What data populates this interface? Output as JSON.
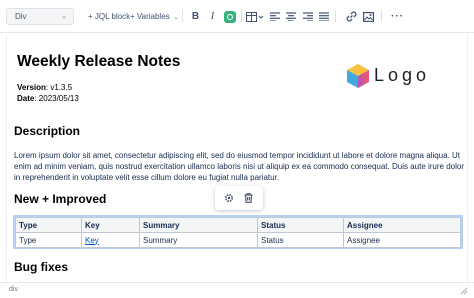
{
  "toolbar": {
    "block_type": "Div",
    "jql_block": "+ JQL block",
    "variables": "+ Variables",
    "accent_color": "#36b37e",
    "icons": [
      "bold-icon",
      "italic-icon",
      "text-color-icon",
      "table-icon",
      "align-left-icon",
      "align-center-icon",
      "align-right-icon",
      "align-justify-icon",
      "link-icon",
      "image-icon",
      "more-icon"
    ]
  },
  "document": {
    "title": "Weekly Release Notes",
    "version_label": "Version",
    "version_value": ": v1.3.5",
    "date_label": "Date",
    "date_value": ": 2023/05/13",
    "logo_text": "Logo",
    "description_heading": "Description",
    "description_text": "Lorem ipsum dolor sit amet, consectetur adipiscing elit, sed do eiusmod tempor incididunt ut labore et dolore magna aliqua. Ut enim ad minim veniam, quis nostrud exercitation ullamco laboris nisi ut aliquip ex ea commodo consequat. Duis aute irure dolor in reprehenderit in voluptate velit esse cillum dolore eu fugiat nulla pariatur.",
    "new_heading": "New + Improved",
    "bugs_heading": "Bug fixes"
  },
  "table": {
    "headers": [
      "Type",
      "Key",
      "Summary",
      "Status",
      "Assignee"
    ],
    "row": [
      "Type",
      "Key",
      "Summary",
      "Status",
      "Assignee"
    ]
  },
  "statusbar": {
    "path": "div"
  }
}
